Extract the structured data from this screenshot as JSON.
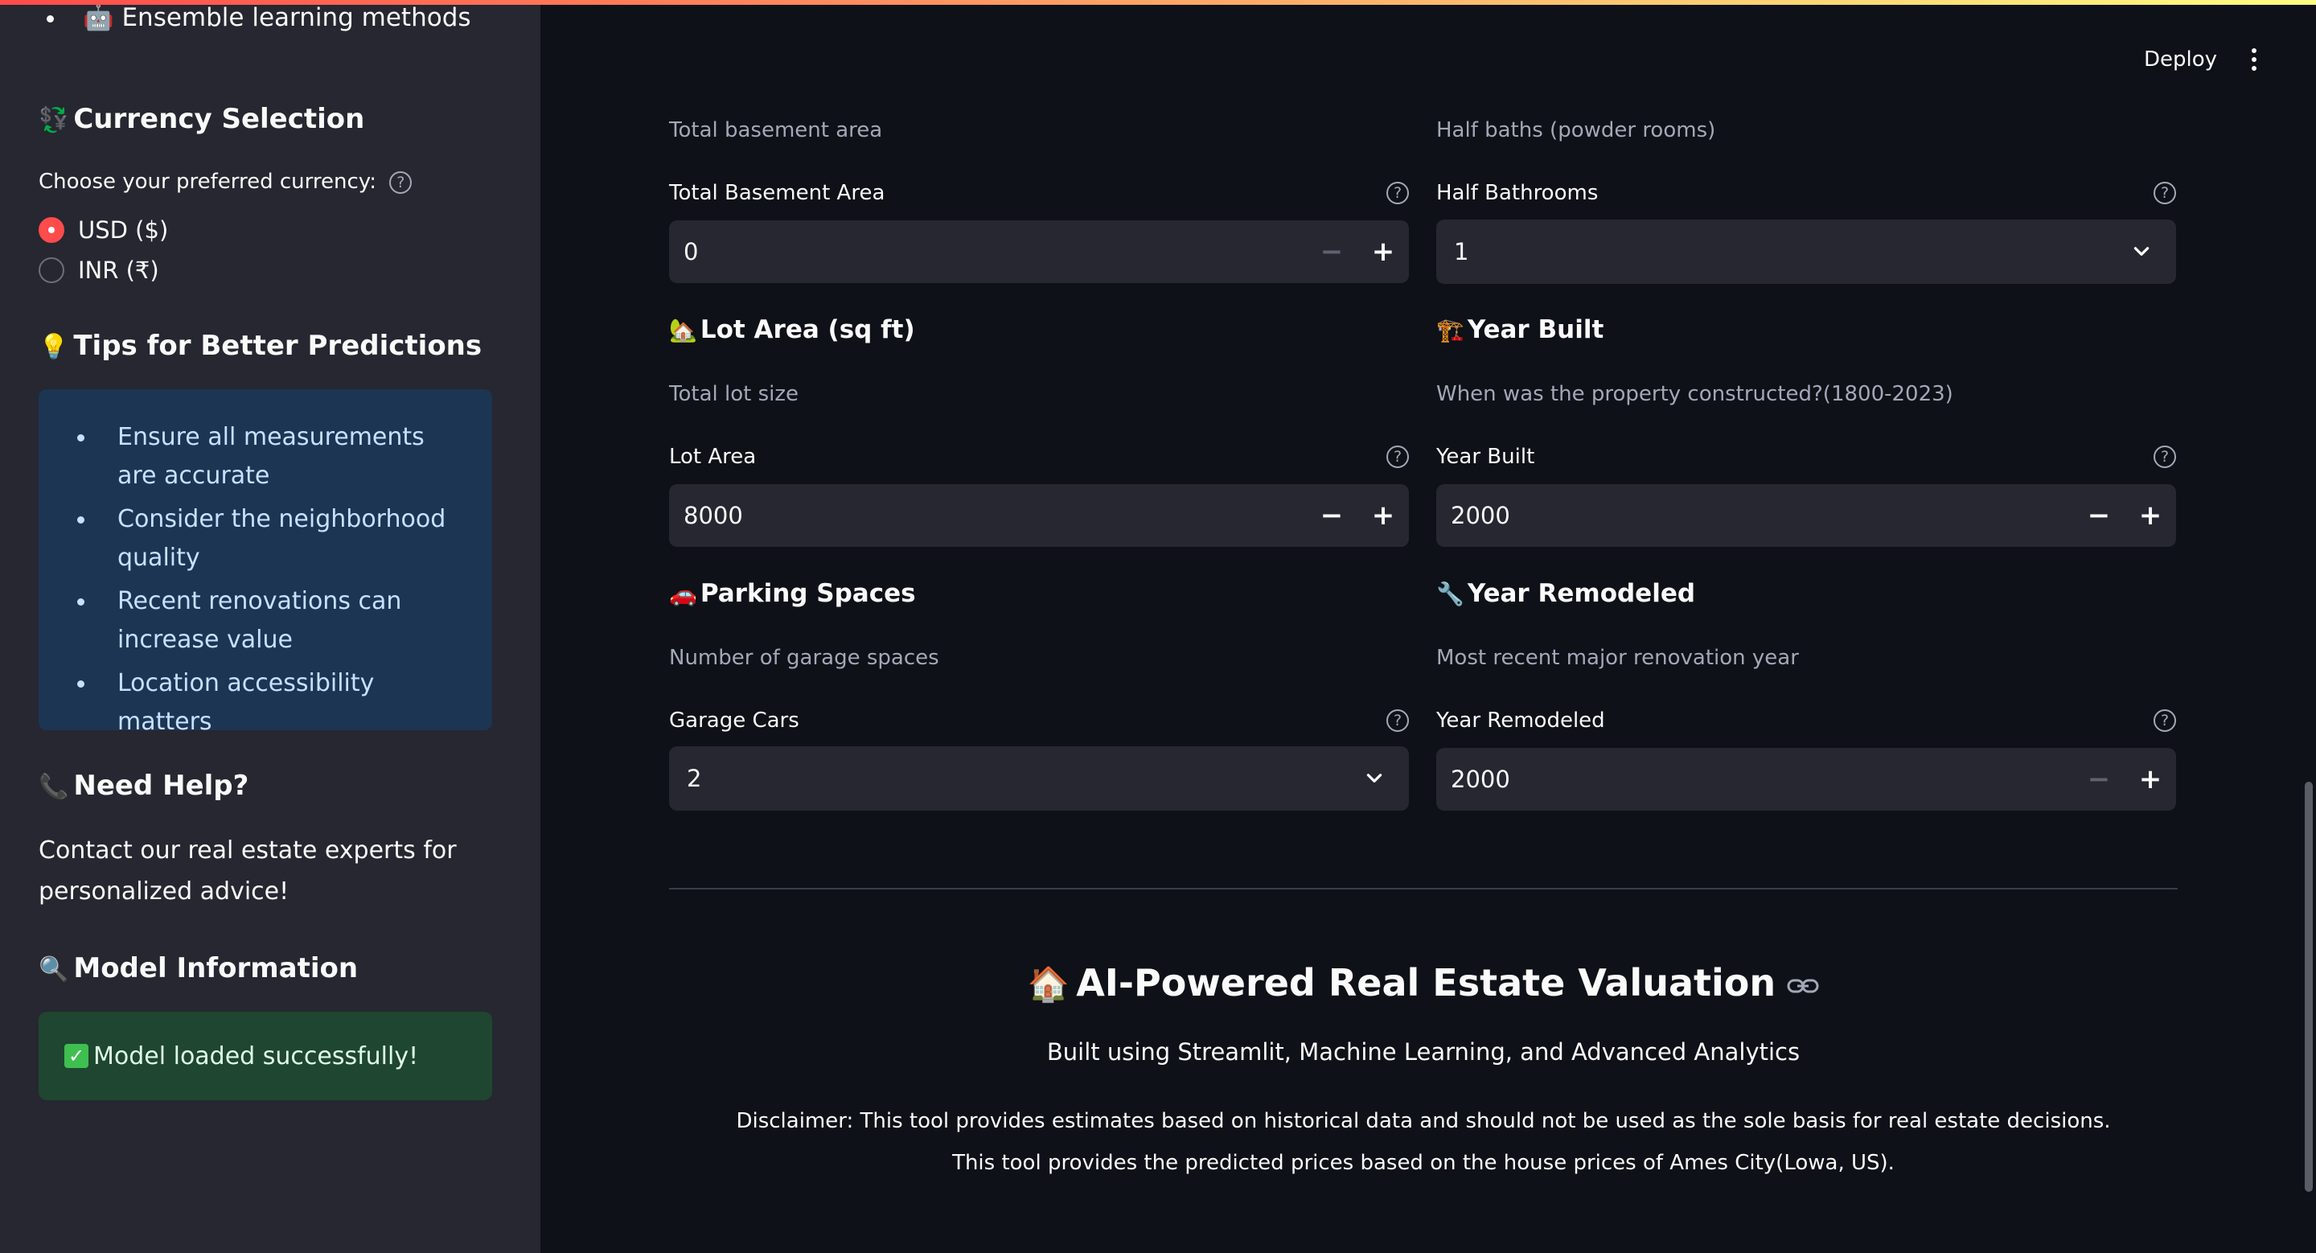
{
  "sidebar": {
    "top_bullet": "Ensemble learning methods",
    "top_bullet_emoji": "🤖",
    "currency": {
      "heading": "Currency Selection",
      "emoji": "💱",
      "label": "Choose your preferred currency:",
      "options": [
        "USD ($)",
        "INR (₹)"
      ],
      "selected": "USD ($)"
    },
    "tips": {
      "heading": "Tips for Better Predictions",
      "emoji": "💡",
      "items": [
        "Ensure all measurements are accurate",
        "Consider the neighborhood quality",
        "Recent renovations can increase value",
        "Location accessibility matters"
      ]
    },
    "help": {
      "heading": "Need Help?",
      "emoji": "📞",
      "text": "Contact our real estate experts for personalized advice!"
    },
    "model": {
      "heading": "Model Information",
      "emoji": "🔍",
      "status": "Model loaded successfully!"
    }
  },
  "header": {
    "deploy_label": "Deploy"
  },
  "main": {
    "basement": {
      "caption": "Total basement area",
      "label": "Total Basement Area",
      "value": "0"
    },
    "half_baths": {
      "caption": "Half baths (powder rooms)",
      "label": "Half Bathrooms",
      "value": "1"
    },
    "lot_area": {
      "heading": "Lot Area (sq ft)",
      "emoji": "🏡",
      "caption": "Total lot size",
      "label": "Lot Area",
      "value": "8000"
    },
    "year_built": {
      "heading": "Year Built",
      "emoji": "🏗️",
      "caption": "When was the property constructed?(1800-2023)",
      "label": "Year Built",
      "value": "2000"
    },
    "parking": {
      "heading": "Parking Spaces",
      "emoji": "🚗",
      "caption": "Number of garage spaces",
      "label": "Garage Cars",
      "value": "2"
    },
    "year_remodeled": {
      "heading": "Year Remodeled",
      "emoji": "🔧",
      "caption": "Most recent major renovation year",
      "label": "Year Remodeled",
      "value": "2000"
    }
  },
  "footer": {
    "title": "AI-Powered Real Estate Valuation",
    "emoji": "🏠",
    "subtitle": "Built using Streamlit, Machine Learning, and Advanced Analytics",
    "disclaimer": "Disclaimer: This tool provides estimates based on historical data and should not be used as the sole basis for real estate decisions.",
    "note": "This tool provides the predicted prices based on the house prices of Ames City(Lowa, US)."
  }
}
